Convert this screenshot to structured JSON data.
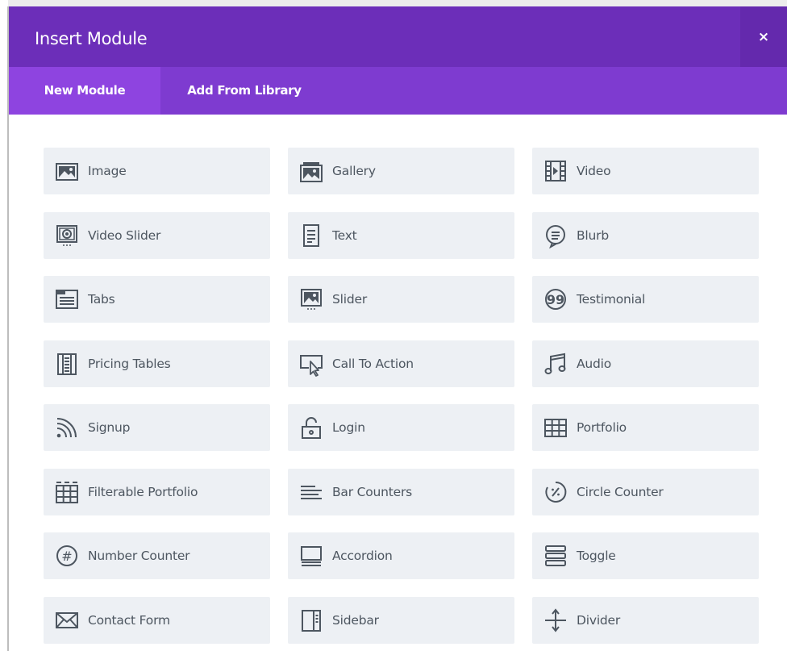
{
  "header": {
    "title": "Insert Module",
    "close_label": "×"
  },
  "tabs": [
    {
      "label": "New Module",
      "active": true
    },
    {
      "label": "Add From Library",
      "active": false
    }
  ],
  "colors": {
    "header_bg": "#6c2eb9",
    "tabs_bg": "#7e3bd0",
    "active_tab_bg": "#8e44e0",
    "card_bg": "#edf0f4",
    "card_text": "#4d5660"
  },
  "modules": [
    {
      "label": "Image",
      "icon": "image-icon"
    },
    {
      "label": "Gallery",
      "icon": "gallery-icon"
    },
    {
      "label": "Video",
      "icon": "video-icon"
    },
    {
      "label": "Video Slider",
      "icon": "video-slider-icon"
    },
    {
      "label": "Text",
      "icon": "text-icon"
    },
    {
      "label": "Blurb",
      "icon": "blurb-icon"
    },
    {
      "label": "Tabs",
      "icon": "tabs-icon"
    },
    {
      "label": "Slider",
      "icon": "slider-icon"
    },
    {
      "label": "Testimonial",
      "icon": "testimonial-icon"
    },
    {
      "label": "Pricing Tables",
      "icon": "pricing-tables-icon"
    },
    {
      "label": "Call To Action",
      "icon": "call-to-action-icon"
    },
    {
      "label": "Audio",
      "icon": "audio-icon"
    },
    {
      "label": "Signup",
      "icon": "signup-icon"
    },
    {
      "label": "Login",
      "icon": "login-icon"
    },
    {
      "label": "Portfolio",
      "icon": "portfolio-icon"
    },
    {
      "label": "Filterable Portfolio",
      "icon": "filterable-portfolio-icon"
    },
    {
      "label": "Bar Counters",
      "icon": "bar-counters-icon"
    },
    {
      "label": "Circle Counter",
      "icon": "circle-counter-icon"
    },
    {
      "label": "Number Counter",
      "icon": "number-counter-icon"
    },
    {
      "label": "Accordion",
      "icon": "accordion-icon"
    },
    {
      "label": "Toggle",
      "icon": "toggle-icon"
    },
    {
      "label": "Contact Form",
      "icon": "contact-form-icon"
    },
    {
      "label": "Sidebar",
      "icon": "sidebar-icon"
    },
    {
      "label": "Divider",
      "icon": "divider-icon"
    }
  ]
}
